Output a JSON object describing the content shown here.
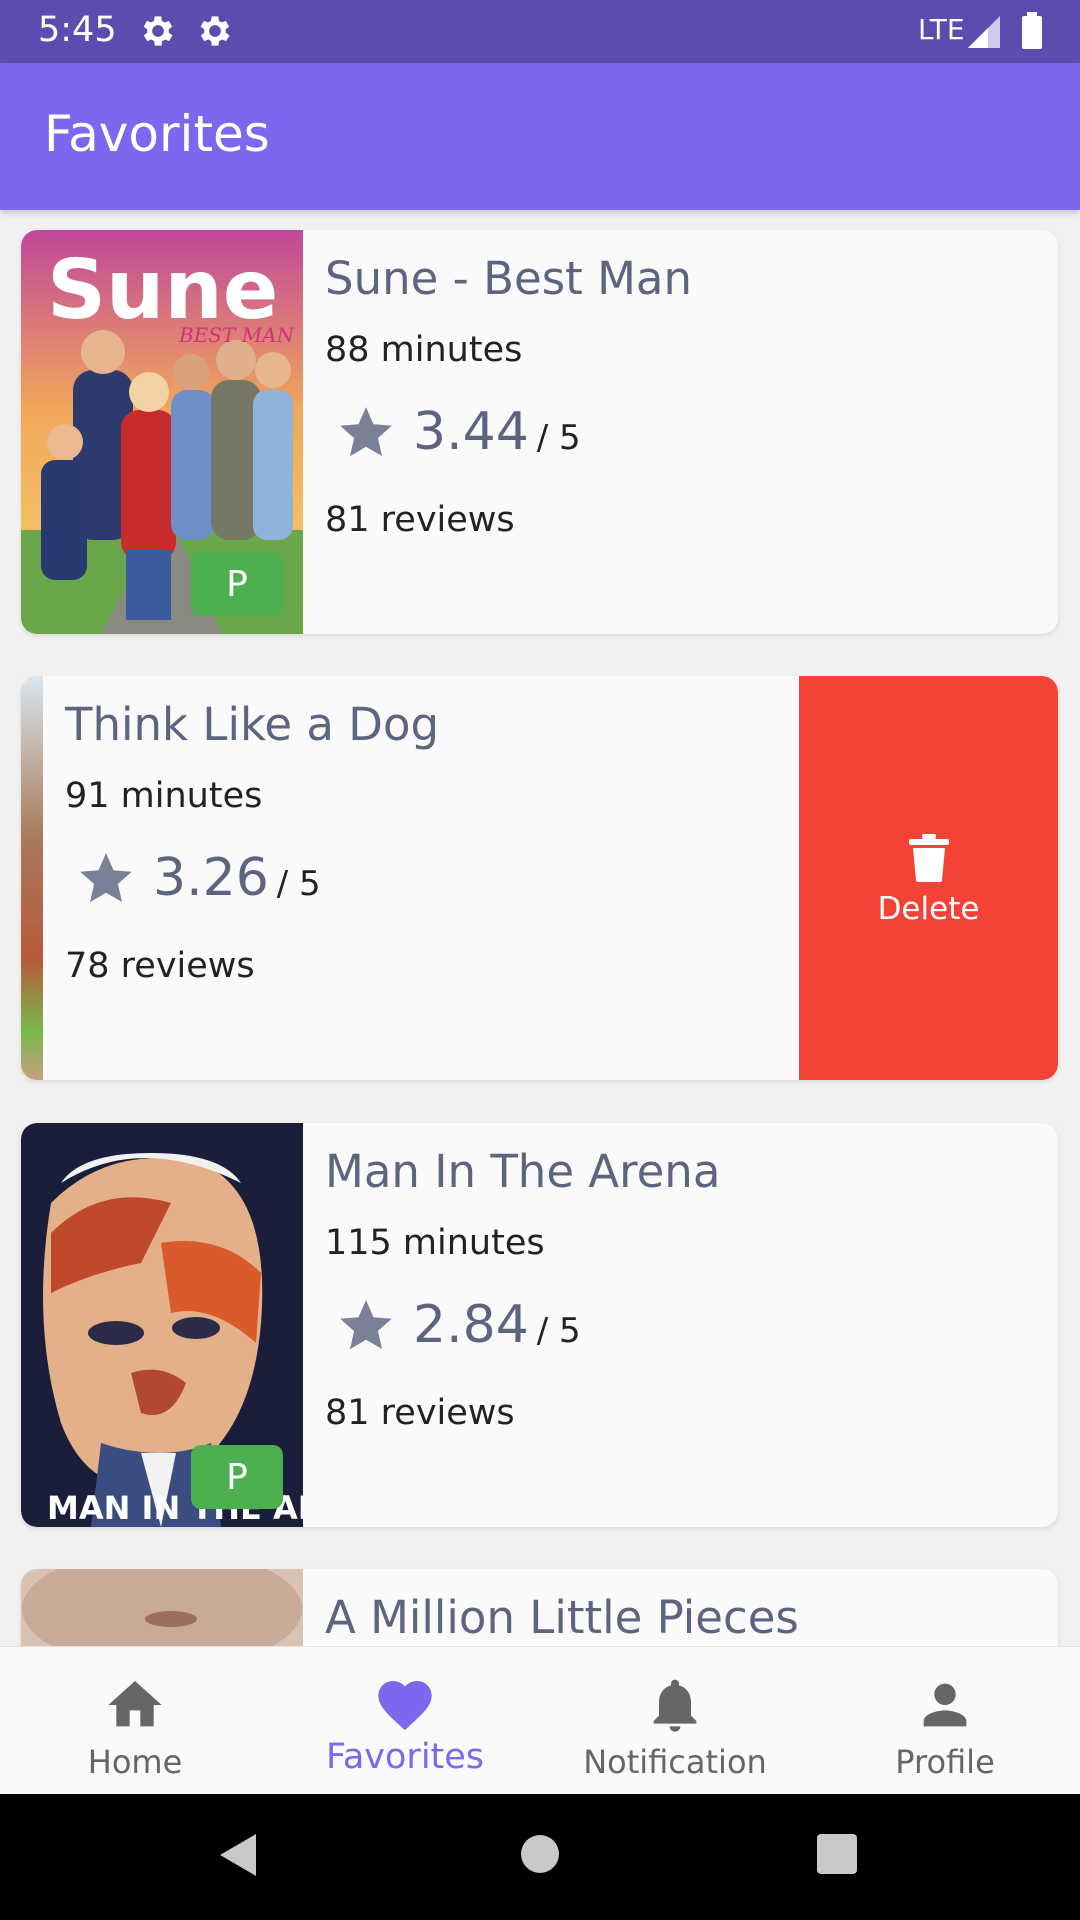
{
  "status_bar": {
    "time": "5:45",
    "network": "LTE",
    "icons": [
      "gear-icon",
      "gear-icon",
      "signal-icon",
      "battery-icon"
    ]
  },
  "app_bar": {
    "title": "Favorites"
  },
  "favorites": [
    {
      "title": "Sune - Best Man",
      "duration": "88 minutes",
      "rating": "3.44",
      "rating_max": "/ 5",
      "reviews": "81 reviews",
      "badge": "P",
      "poster_text": "Sune",
      "poster_subtext": "BEST MAN"
    },
    {
      "title": "Think Like a Dog",
      "duration": "91 minutes",
      "rating": "3.26",
      "rating_max": "/ 5",
      "reviews": "78 reviews",
      "swipe_action": "Delete"
    },
    {
      "title": "Man In The Arena",
      "duration": "115 minutes",
      "rating": "2.84",
      "rating_max": "/ 5",
      "reviews": "81 reviews",
      "badge": "P",
      "poster_text": "MAN IN THE ARENA"
    },
    {
      "title": "A Million Little Pieces"
    }
  ],
  "bottom_nav": [
    {
      "label": "Home",
      "icon": "home-icon",
      "active": false
    },
    {
      "label": "Favorites",
      "icon": "heart-icon",
      "active": true
    },
    {
      "label": "Notification",
      "icon": "bell-icon",
      "active": false
    },
    {
      "label": "Profile",
      "icon": "person-icon",
      "active": false
    }
  ],
  "colors": {
    "primary": "#7b68ee",
    "status_bar": "#5c4cb0",
    "delete": "#f44336",
    "badge": "#4caf50",
    "accent_text": "#5d6480"
  }
}
